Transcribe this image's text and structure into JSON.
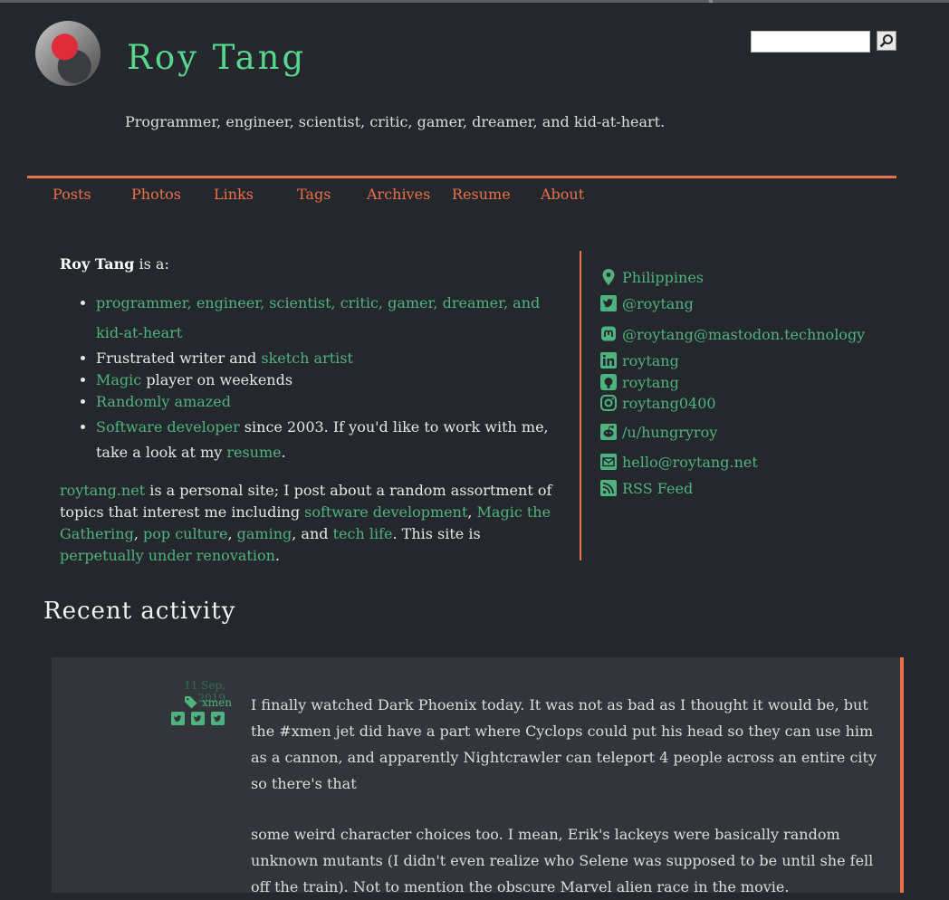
{
  "header": {
    "title": "Roy Tang",
    "tagline": "Programmer, engineer, scientist, critic, gamer, dreamer, and kid-at-heart."
  },
  "search": {
    "placeholder": ""
  },
  "nav": [
    "Posts",
    "Photos",
    "Links",
    "Tags",
    "Archives",
    "Resume",
    "About"
  ],
  "intro": {
    "lead_name": "Roy Tang",
    "lead_suffix": " is a:",
    "list": {
      "item1": "programmer, engineer, scientist, critic, gamer, dreamer, and kid-at-heart",
      "item2_text": "Frustrated writer and ",
      "item2_link": "sketch artist",
      "item3_link": "Magic",
      "item3_text": " player on weekends",
      "item4_link": "Randomly amazed",
      "item5_link1": "Software developer",
      "item5_text": " since 2003. If you'd like to work with me, take a look at my ",
      "item5_link2": "resume",
      "item5_end": "."
    },
    "para": {
      "site_link": "roytang.net",
      "t1": " is a personal site; I post about a random assortment of topics that interest me including ",
      "l1": "software development",
      "s1": ", ",
      "l2": "Magic the Gathering",
      "s2": ", ",
      "l3": "pop culture",
      "s3": ", ",
      "l4": "gaming",
      "s4": ", and ",
      "l5": "tech life",
      "t2": ". This site is ",
      "l6": "perpetually under renovation",
      "t3": "."
    }
  },
  "contacts": {
    "location": "Philippines",
    "twitter": "@roytang",
    "mastodon": "@roytang@mastodon.technology",
    "linkedin": "roytang",
    "github": "roytang",
    "instagram": "roytang0400",
    "reddit": "/u/hungryroy",
    "email": "hello@roytang.net",
    "rss": "RSS Feed"
  },
  "recent": {
    "heading": "Recent activity",
    "card": {
      "date": "11 Sep, 2019",
      "tag": "xmen",
      "p1": "I finally watched Dark Phoenix today. It was not as bad as I thought it would be, but the #xmen jet did have a part where Cyclops could put his head so they can use him as a cannon, and apparently Nightcrawler can teleport 4 people across an entire city so there's that",
      "p2": "some weird character choices too. I mean, Erik's lackeys were basically random unknown mutants (I didn't even realize who Selene was supposed to be until she fell off the train). Not to mention the obscure Marvel alien race in the movie."
    }
  },
  "colors": {
    "background": "#24272c",
    "accent": "#e8704a",
    "link": "#4fb37f",
    "title": "#58d68d",
    "card": "#32363b"
  },
  "icons": [
    "search-icon",
    "map-marker-icon",
    "twitter-icon",
    "mastodon-icon",
    "linkedin-icon",
    "github-icon",
    "instagram-icon",
    "reddit-icon",
    "envelope-icon",
    "rss-icon",
    "tag-icon"
  ]
}
